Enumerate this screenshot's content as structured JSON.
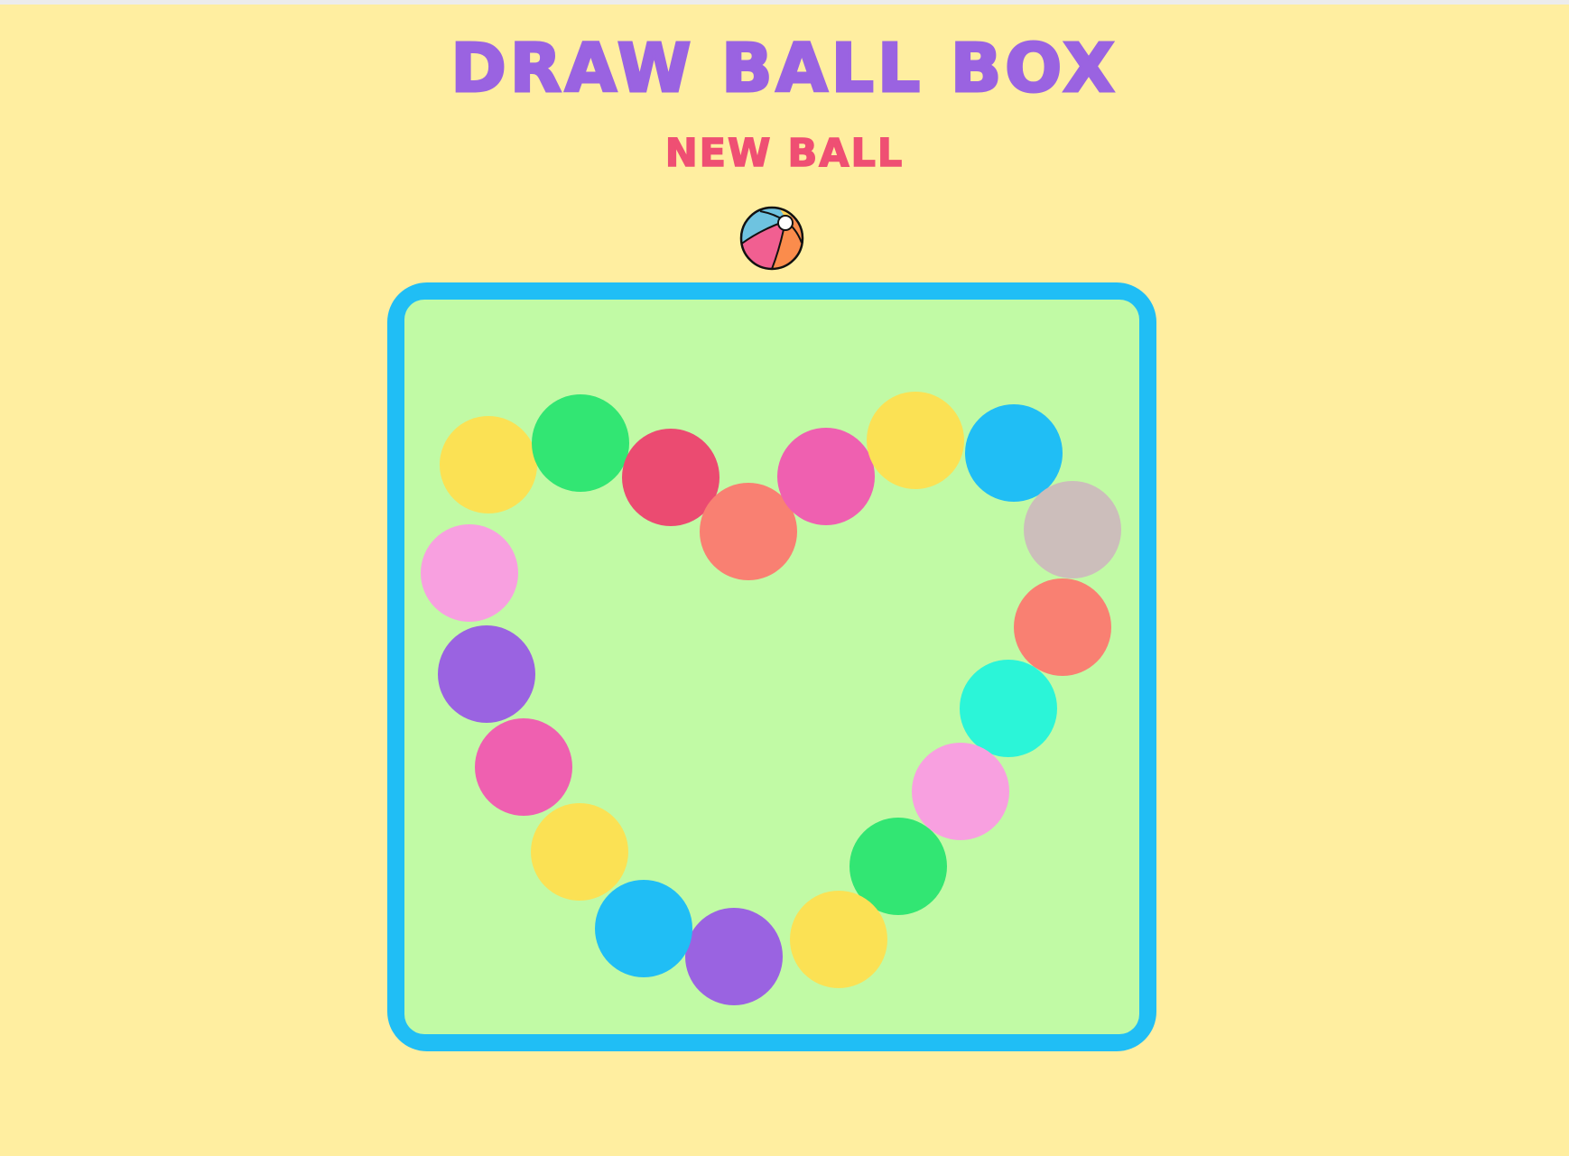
{
  "app": {
    "title": "DRAW BALL BOX",
    "new_ball_label": "NEW BALL",
    "spawner_icon": "beach-ball-icon"
  },
  "colors": {
    "background": "#ffeea0",
    "title": "#9a63e1",
    "new_ball": "#ef4f73",
    "box_border": "#20bef5",
    "box_fill": "#c1faa5",
    "beach_ball": [
      "#6ec3e0",
      "#f15f91",
      "#fb8c4c",
      "#ffd255"
    ]
  },
  "balls": [
    {
      "color": "#fbe154"
    },
    {
      "color": "#32e673"
    },
    {
      "color": "#eb4b71"
    },
    {
      "color": "#f98072"
    },
    {
      "color": "#ef60b0"
    },
    {
      "color": "#fbe154"
    },
    {
      "color": "#20bef5"
    },
    {
      "color": "#ccbebb"
    },
    {
      "color": "#f98072"
    },
    {
      "color": "#2bf5d8"
    },
    {
      "color": "#f8a0e0"
    },
    {
      "color": "#32e673"
    },
    {
      "color": "#fbe154"
    },
    {
      "color": "#9a63e1"
    },
    {
      "color": "#20bef5"
    },
    {
      "color": "#fbe154"
    },
    {
      "color": "#ef60b0"
    },
    {
      "color": "#9a63e1"
    },
    {
      "color": "#f8a0e0"
    }
  ]
}
